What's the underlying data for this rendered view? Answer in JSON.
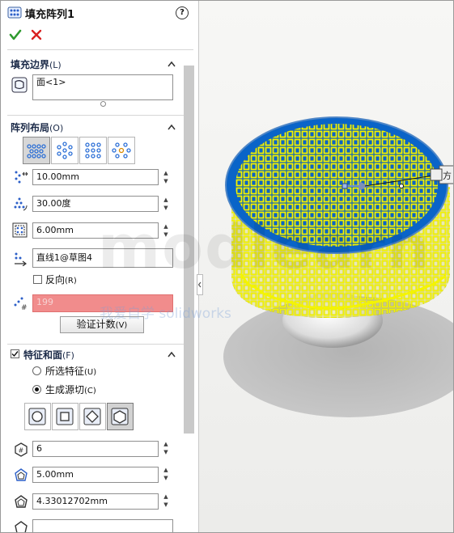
{
  "window": {
    "title": "填充阵列1"
  },
  "actions": {
    "ok_icon": "check-icon",
    "cancel_icon": "x-icon",
    "help_label": "?"
  },
  "fill_boundary": {
    "title": "填充边界",
    "key": "(L)",
    "value": "面<1>"
  },
  "pattern_layout": {
    "title": "阵列布局",
    "key": "(O)",
    "layouts": [
      "perforation",
      "circular",
      "square",
      "polygon"
    ],
    "selected_layout": 0,
    "spacing": "10.00mm",
    "angle": "30.00度",
    "margin": "6.00mm",
    "direction": "直线1@草图4",
    "reverse_label": "反向",
    "reverse_key": "(R)",
    "count": "199",
    "verify_label": "验证计数",
    "verify_key": "(V)"
  },
  "features_faces": {
    "title": "特征和面",
    "key": "(F)",
    "checked": true,
    "option_selected_feature": "所选特征",
    "option_selected_feature_key": "(U)",
    "option_create_seed": "生成源切",
    "option_create_seed_key": "(C)",
    "selected_option": 1,
    "seed_shapes": [
      "circle",
      "square",
      "diamond",
      "polygon"
    ],
    "selected_shape": 3,
    "sides": "6",
    "diameter": "5.00mm",
    "vertex_distance": "4.33012702mm"
  },
  "watermark": {
    "text": "modlearn",
    "subtitle": "我爱自学 solidworks"
  },
  "colors": {
    "accent": "#f18c8c",
    "fill_yellow": "#f4f400",
    "face_blue": "#0a64c8",
    "ok_green": "#2e9a2e",
    "cancel_red": "#d92020"
  }
}
